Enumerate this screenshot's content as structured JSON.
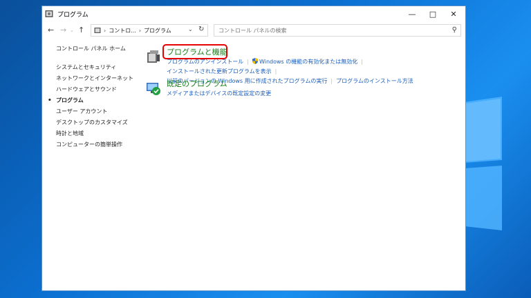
{
  "window": {
    "title": "プログラム"
  },
  "address": {
    "crumbs": [
      "コントロ...",
      "プログラム"
    ],
    "search_placeholder": "コントロール パネルの検索"
  },
  "sidebar": {
    "home": "コントロール パネル ホーム",
    "items": [
      {
        "label": "システムとセキュリティ"
      },
      {
        "label": "ネットワークとインターネット"
      },
      {
        "label": "ハードウェアとサウンド"
      },
      {
        "label": "プログラム",
        "active": true
      },
      {
        "label": "ユーザー アカウント"
      },
      {
        "label": "デスクトップのカスタマイズ"
      },
      {
        "label": "時計と地域"
      },
      {
        "label": "コンピューターの簡単操作"
      }
    ]
  },
  "sections": {
    "programs": {
      "title": "プログラムと機能",
      "links": [
        "プログラムのアンインストール",
        "Windows の機能の有効化または無効化",
        "インストールされた更新プログラムを表示",
        "以前のバージョンの Windows 用に作成されたプログラムの実行",
        "プログラムのインストール方法"
      ]
    },
    "defaults": {
      "title": "既定のプログラム",
      "links": [
        "メディアまたはデバイスの既定設定の変更"
      ]
    }
  },
  "colors": {
    "accent_green": "#1a7f1a",
    "link_blue": "#1b5cb8",
    "highlight_red": "#e60000"
  }
}
